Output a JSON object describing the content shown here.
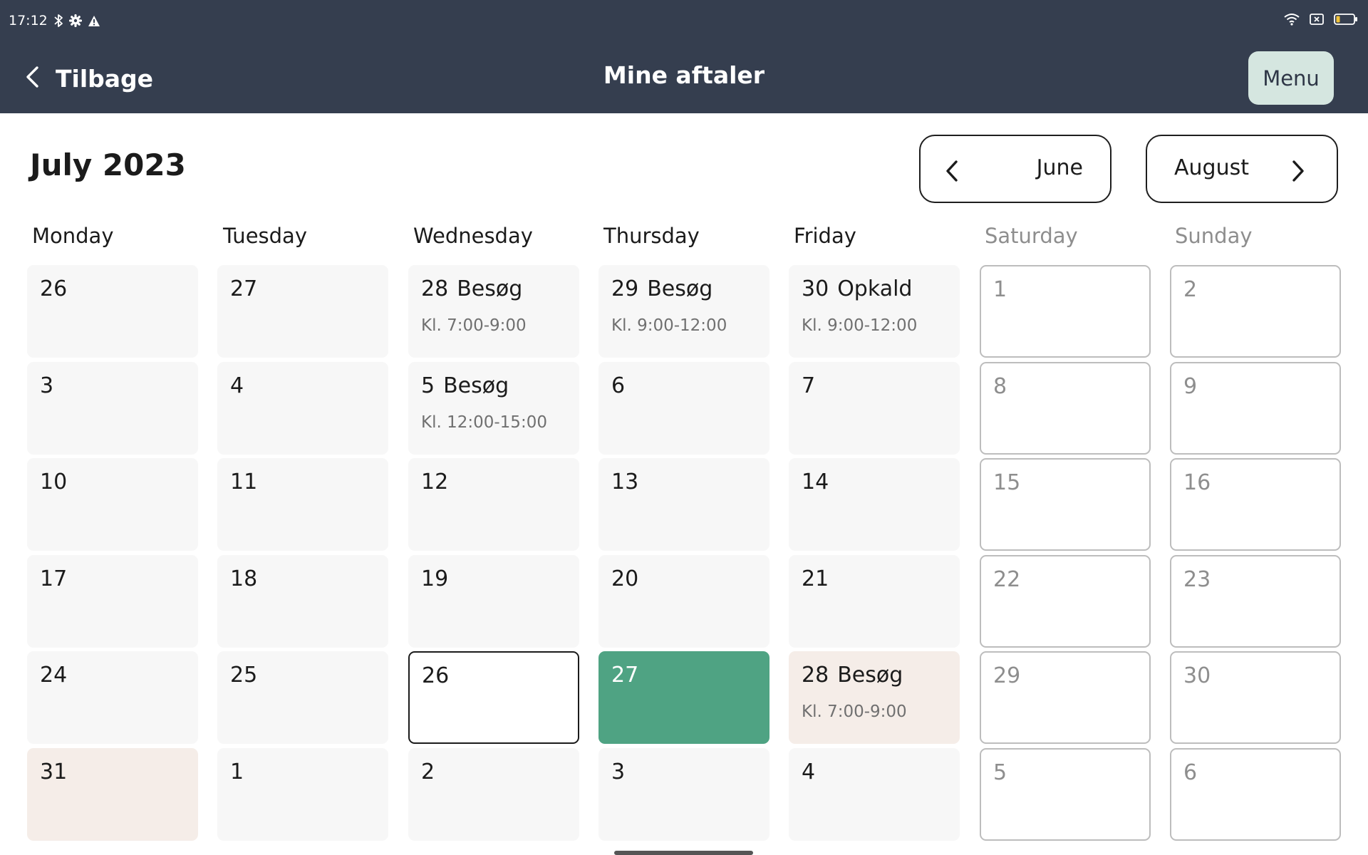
{
  "status_bar": {
    "time": "17:12",
    "icons_left": [
      "bluetooth-icon",
      "settings-gear-icon",
      "warning-icon"
    ],
    "icons_right": [
      "wifi-icon",
      "sim-card-icon",
      "battery-icon"
    ]
  },
  "header": {
    "back_label": "Tilbage",
    "title": "Mine aftaler",
    "menu_label": "Menu",
    "background_color": "#353e4f",
    "menu_button_color": "#d5e6e0"
  },
  "calendar": {
    "month_title": "July 2023",
    "prev_label": "June",
    "next_label": "August",
    "weekdays": [
      "Monday",
      "Tuesday",
      "Wednesday",
      "Thursday",
      "Friday",
      "Saturday",
      "Sunday"
    ],
    "weeks": [
      [
        {
          "day": "26",
          "event": "",
          "time": "",
          "state": "default"
        },
        {
          "day": "27",
          "event": "",
          "time": "",
          "state": "default"
        },
        {
          "day": "28",
          "event": "Besøg",
          "time": "Kl. 7:00-9:00",
          "state": "default"
        },
        {
          "day": "29",
          "event": "Besøg",
          "time": "Kl. 9:00-12:00",
          "state": "default"
        },
        {
          "day": "30",
          "event": "Opkald",
          "time": "Kl. 9:00-12:00",
          "state": "default"
        },
        {
          "day": "1",
          "event": "",
          "time": "",
          "state": "weekend"
        },
        {
          "day": "2",
          "event": "",
          "time": "",
          "state": "weekend"
        }
      ],
      [
        {
          "day": "3",
          "event": "",
          "time": "",
          "state": "default"
        },
        {
          "day": "4",
          "event": "",
          "time": "",
          "state": "default"
        },
        {
          "day": "5",
          "event": "Besøg",
          "time": "Kl. 12:00-15:00",
          "state": "default"
        },
        {
          "day": "6",
          "event": "",
          "time": "",
          "state": "default"
        },
        {
          "day": "7",
          "event": "",
          "time": "",
          "state": "default"
        },
        {
          "day": "8",
          "event": "",
          "time": "",
          "state": "weekend"
        },
        {
          "day": "9",
          "event": "",
          "time": "",
          "state": "weekend"
        }
      ],
      [
        {
          "day": "10",
          "event": "",
          "time": "",
          "state": "default"
        },
        {
          "day": "11",
          "event": "",
          "time": "",
          "state": "default"
        },
        {
          "day": "12",
          "event": "",
          "time": "",
          "state": "default"
        },
        {
          "day": "13",
          "event": "",
          "time": "",
          "state": "default"
        },
        {
          "day": "14",
          "event": "",
          "time": "",
          "state": "default"
        },
        {
          "day": "15",
          "event": "",
          "time": "",
          "state": "weekend"
        },
        {
          "day": "16",
          "event": "",
          "time": "",
          "state": "weekend"
        }
      ],
      [
        {
          "day": "17",
          "event": "",
          "time": "",
          "state": "default"
        },
        {
          "day": "18",
          "event": "",
          "time": "",
          "state": "default"
        },
        {
          "day": "19",
          "event": "",
          "time": "",
          "state": "default"
        },
        {
          "day": "20",
          "event": "",
          "time": "",
          "state": "default"
        },
        {
          "day": "21",
          "event": "",
          "time": "",
          "state": "default"
        },
        {
          "day": "22",
          "event": "",
          "time": "",
          "state": "weekend"
        },
        {
          "day": "23",
          "event": "",
          "time": "",
          "state": "weekend"
        }
      ],
      [
        {
          "day": "24",
          "event": "",
          "time": "",
          "state": "default"
        },
        {
          "day": "25",
          "event": "",
          "time": "",
          "state": "default"
        },
        {
          "day": "26",
          "event": "",
          "time": "",
          "state": "selected"
        },
        {
          "day": "27",
          "event": "",
          "time": "",
          "state": "today"
        },
        {
          "day": "28",
          "event": "Besøg",
          "time": "Kl. 7:00-9:00",
          "state": "highlight"
        },
        {
          "day": "29",
          "event": "",
          "time": "",
          "state": "weekend"
        },
        {
          "day": "30",
          "event": "",
          "time": "",
          "state": "weekend"
        }
      ],
      [
        {
          "day": "31",
          "event": "",
          "time": "",
          "state": "highlight"
        },
        {
          "day": "1",
          "event": "",
          "time": "",
          "state": "default"
        },
        {
          "day": "2",
          "event": "",
          "time": "",
          "state": "default"
        },
        {
          "day": "3",
          "event": "",
          "time": "",
          "state": "default"
        },
        {
          "day": "4",
          "event": "",
          "time": "",
          "state": "default"
        },
        {
          "day": "5",
          "event": "",
          "time": "",
          "state": "weekend"
        },
        {
          "day": "6",
          "event": "",
          "time": "",
          "state": "weekend"
        }
      ]
    ],
    "colors": {
      "today": "#4fa383",
      "highlight": "#f5ede8",
      "cell": "#f7f7f7",
      "weekend_border": "#bdbdbd"
    }
  }
}
